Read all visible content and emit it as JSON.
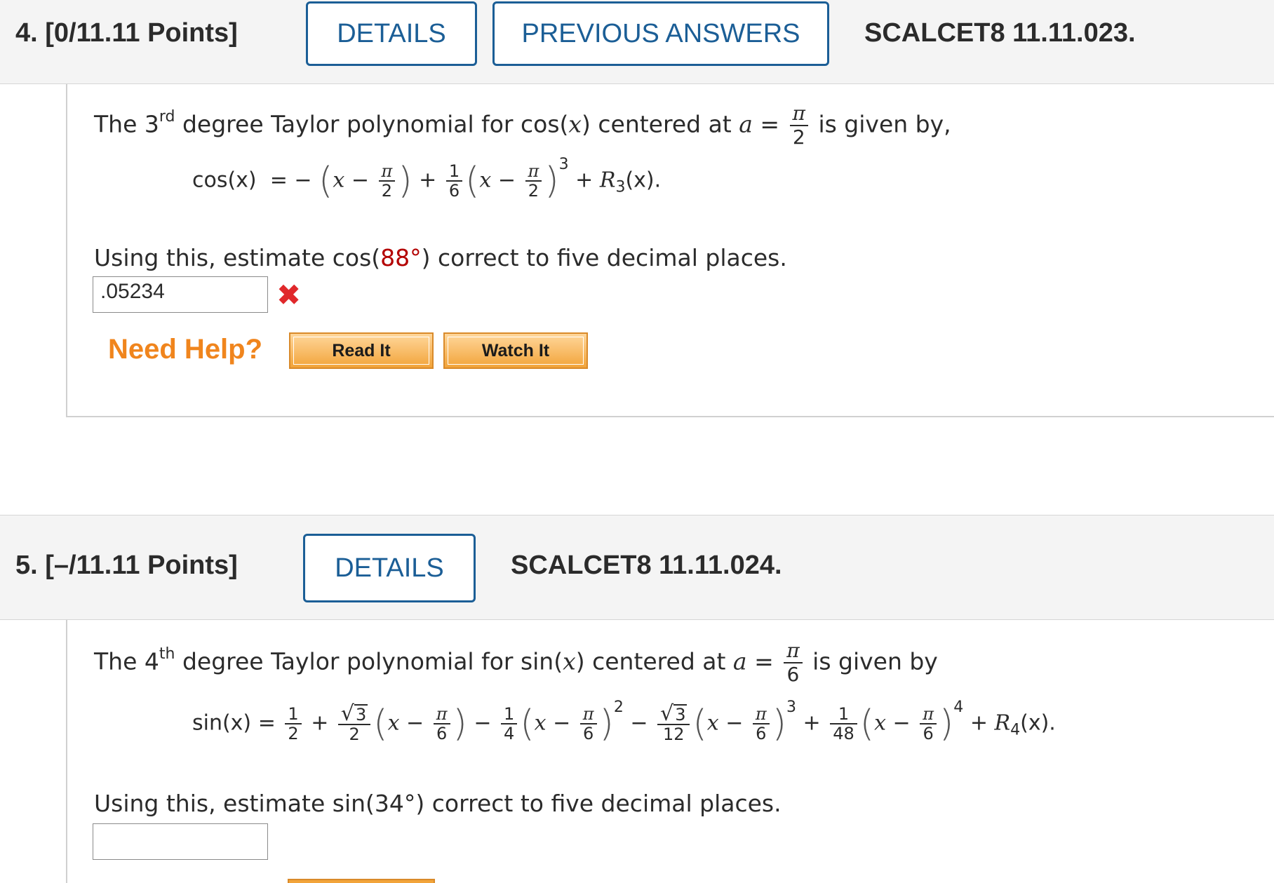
{
  "q4": {
    "number": "4.",
    "points": "[0/11.11 Points]",
    "details_label": "DETAILS",
    "previous_answers_label": "PREVIOUS ANSWERS",
    "code": "SCALCET8 11.11.023.",
    "intro_pre": "The 3",
    "intro_sup": "rd",
    "intro_mid": " degree Taylor polynomial for cos(",
    "intro_var": "x",
    "intro_post": ") centered at ",
    "intro_a": "a",
    "intro_eq": " =",
    "center_num": "π",
    "center_den": "2",
    "intro_end": "is given by,",
    "formula_lhs": "cos(x)",
    "formula_eq": "=",
    "formula_minus": "−",
    "term_x": "x",
    "term_pi": "π",
    "term_2": "2",
    "coef_num": "1",
    "coef_den": "6",
    "power": "3",
    "remainder": "R",
    "remainder_sub": "3",
    "remainder_arg": "(x).",
    "prompt_pre": "Using this, estimate cos(",
    "prompt_val": "88°",
    "prompt_post": ") correct to five decimal places.",
    "answer_value": ".05234",
    "need_help": "Need Help?",
    "read_it": "Read It",
    "watch_it": "Watch It"
  },
  "q5": {
    "number": "5.",
    "points": "[–/11.11 Points]",
    "details_label": "DETAILS",
    "code": "SCALCET8 11.11.024.",
    "intro_pre": "The 4",
    "intro_sup": "th",
    "intro_mid": " degree Taylor polynomial for sin(",
    "intro_var": "x",
    "intro_post": ") centered at ",
    "intro_a": "a",
    "intro_eq": " =",
    "center_num": "π",
    "center_den": "6",
    "intro_end": "is given by",
    "formula_lhs": "sin(x)",
    "formula_eq": "=",
    "c0_num": "1",
    "c0_den": "2",
    "c1_num": "3",
    "c1_den": "2",
    "c2_num": "1",
    "c2_den": "4",
    "c3_num": "3",
    "c3_den": "12",
    "c4_num": "1",
    "c4_den": "48",
    "pw2": "2",
    "pw3": "3",
    "pw4": "4",
    "term_x": "x",
    "term_pi": "π",
    "term_6": "6",
    "plus": "+",
    "minus": "−",
    "remainder": "R",
    "remainder_sub": "4",
    "remainder_arg": "(x).",
    "prompt_pre": "Using this, estimate sin(",
    "prompt_val": "34°",
    "prompt_post": ") correct to five decimal places.",
    "answer_value": ""
  },
  "colors": {
    "button_blue": "#1b5e96",
    "help_orange": "#f0851d",
    "wrong_red": "#e0282b",
    "degree_red": "#b30000"
  }
}
